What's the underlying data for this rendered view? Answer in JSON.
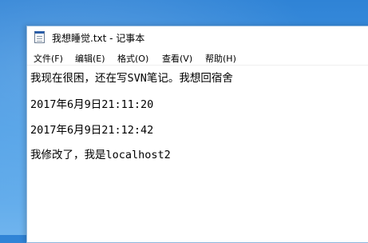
{
  "window": {
    "title": "我想睡觉.txt - 记事本"
  },
  "menu": [
    {
      "label": "文件(F)"
    },
    {
      "label": "编辑(E)"
    },
    {
      "label": "格式(O)"
    },
    {
      "label": "查看(V)"
    },
    {
      "label": "帮助(H)"
    }
  ],
  "editor": {
    "lines": [
      "我现在很困，还在写SVN笔记。我想回宿舍",
      "",
      "2017年6月9日21:11:20",
      "",
      "2017年6月9日21:12:42",
      "",
      "我修改了，我是localhost2"
    ]
  },
  "icons": {
    "app": "notepad-icon"
  }
}
